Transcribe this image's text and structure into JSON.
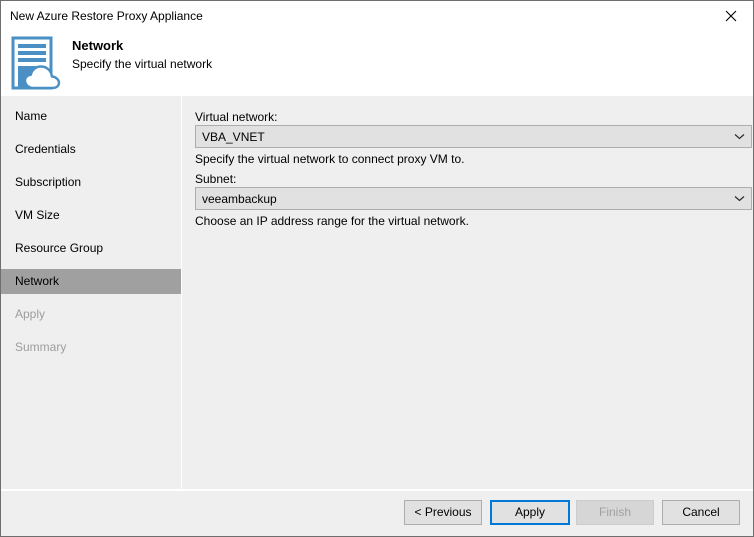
{
  "window": {
    "title": "New Azure Restore Proxy Appliance",
    "close_icon": "close-icon"
  },
  "header": {
    "icon": "azure-vm-cloud-icon",
    "title": "Network",
    "subtitle": "Specify the virtual network"
  },
  "sidebar": {
    "items": [
      {
        "label": "Name",
        "state": "normal"
      },
      {
        "label": "Credentials",
        "state": "normal"
      },
      {
        "label": "Subscription",
        "state": "normal"
      },
      {
        "label": "VM Size",
        "state": "normal"
      },
      {
        "label": "Resource Group",
        "state": "normal"
      },
      {
        "label": "Network",
        "state": "selected"
      },
      {
        "label": "Apply",
        "state": "disabled"
      },
      {
        "label": "Summary",
        "state": "disabled"
      }
    ]
  },
  "content": {
    "virtual_network": {
      "label": "Virtual network:",
      "value": "VBA_VNET",
      "hint": "Specify the virtual network to connect proxy VM to.",
      "arrow_icon": "chevron-down-icon"
    },
    "subnet": {
      "label": "Subnet:",
      "value": "veeambackup",
      "hint": "Choose an IP address range for the virtual network.",
      "arrow_icon": "chevron-down-icon"
    }
  },
  "footer": {
    "previous_label": "< Previous",
    "apply_label": "Apply",
    "finish_label": "Finish",
    "cancel_label": "Cancel"
  },
  "colors": {
    "accent": "#0078d7",
    "icon_blue": "#4a90c4",
    "selected_nav": "#a0a0a0",
    "panel": "#efeff0",
    "control": "#e1e1e1",
    "control_border": "#adadad",
    "disabled_text": "#a0a0a0"
  }
}
